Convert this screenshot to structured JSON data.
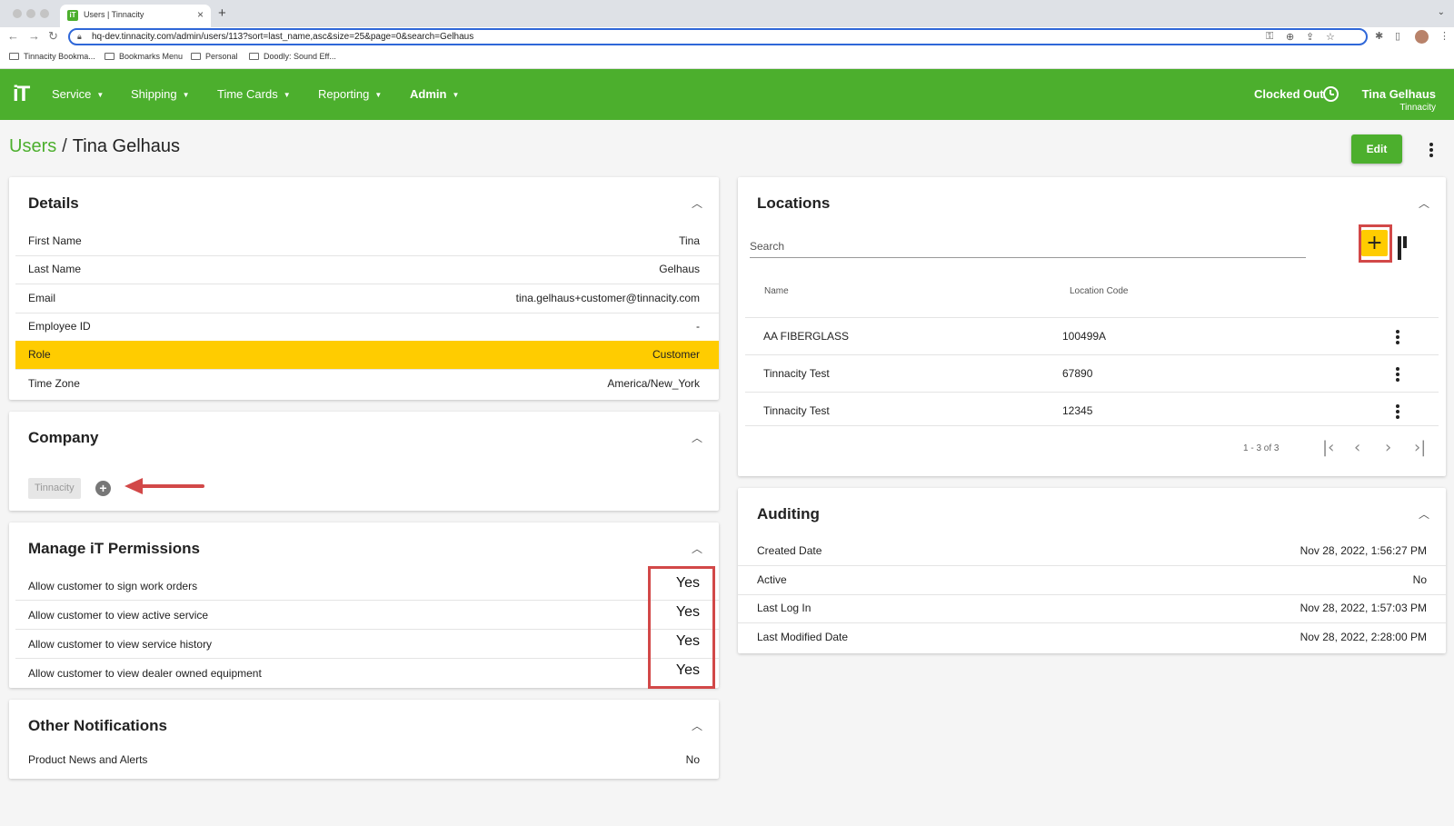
{
  "browser": {
    "tab_title": "Users | Tinnacity",
    "tab_favicon": "iT",
    "url": "hq-dev.tinnacity.com/admin/users/113?sort=last_name,asc&size=25&page=0&search=Gelhaus",
    "bookmarks": [
      "Tinnacity Bookma...",
      "Bookmarks Menu",
      "Personal",
      "Doodly: Sound Eff..."
    ]
  },
  "header": {
    "logo": "iT",
    "nav": [
      {
        "label": "Service"
      },
      {
        "label": "Shipping"
      },
      {
        "label": "Time Cards"
      },
      {
        "label": "Reporting"
      },
      {
        "label": "Admin"
      }
    ],
    "clock_status": "Clocked Out",
    "user_name": "Tina Gelhaus",
    "user_company": "Tinnacity"
  },
  "page": {
    "breadcrumb_root": "Users",
    "breadcrumb_sep": "/",
    "breadcrumb_current": "Tina Gelhaus",
    "edit_label": "Edit"
  },
  "details": {
    "title": "Details",
    "rows": [
      {
        "key": "First Name",
        "value": "Tina"
      },
      {
        "key": "Last Name",
        "value": "Gelhaus"
      },
      {
        "key": "Email",
        "value": "tina.gelhaus+customer@tinnacity.com"
      },
      {
        "key": "Employee ID",
        "value": "-"
      },
      {
        "key": "Role",
        "value": "Customer"
      },
      {
        "key": "Time Zone",
        "value": "America/New_York"
      }
    ]
  },
  "company": {
    "title": "Company",
    "chip": "Tinnacity"
  },
  "permissions": {
    "title": "Manage iT Permissions",
    "rows": [
      {
        "key": "Allow customer to sign work orders",
        "value": "Yes"
      },
      {
        "key": "Allow customer to view active service",
        "value": "Yes"
      },
      {
        "key": "Allow customer to view service history",
        "value": "Yes"
      },
      {
        "key": "Allow customer to view dealer owned equipment",
        "value": "Yes"
      }
    ]
  },
  "notifications": {
    "title": "Other Notifications",
    "rows": [
      {
        "key": "Product News and Alerts",
        "value": "No"
      }
    ]
  },
  "locations": {
    "title": "Locations",
    "search_placeholder": "Search",
    "add_label": "+",
    "columns": [
      "Name",
      "Location Code"
    ],
    "rows": [
      {
        "name": "AA FIBERGLASS",
        "code": "100499A"
      },
      {
        "name": "Tinnacity Test",
        "code": "67890"
      },
      {
        "name": "Tinnacity Test",
        "code": "12345"
      }
    ],
    "pager_label": "1 - 3 of 3"
  },
  "auditing": {
    "title": "Auditing",
    "rows": [
      {
        "key": "Created Date",
        "value": "Nov 28, 2022, 1:56:27 PM"
      },
      {
        "key": "Active",
        "value": "No"
      },
      {
        "key": "Last Log In",
        "value": "Nov 28, 2022, 1:57:03 PM"
      },
      {
        "key": "Last Modified Date",
        "value": "Nov 28, 2022, 2:28:00 PM"
      }
    ]
  },
  "colors": {
    "brand_green": "#4caf2d",
    "highlight_yellow": "#ffcc00",
    "annotation_red": "#d24848"
  },
  "icons": {
    "collapse": "chevron-up-icon",
    "kebab": "more-vert-icon",
    "columns": "view-columns-icon",
    "clock": "clock-icon",
    "add": "add-circle-icon"
  }
}
